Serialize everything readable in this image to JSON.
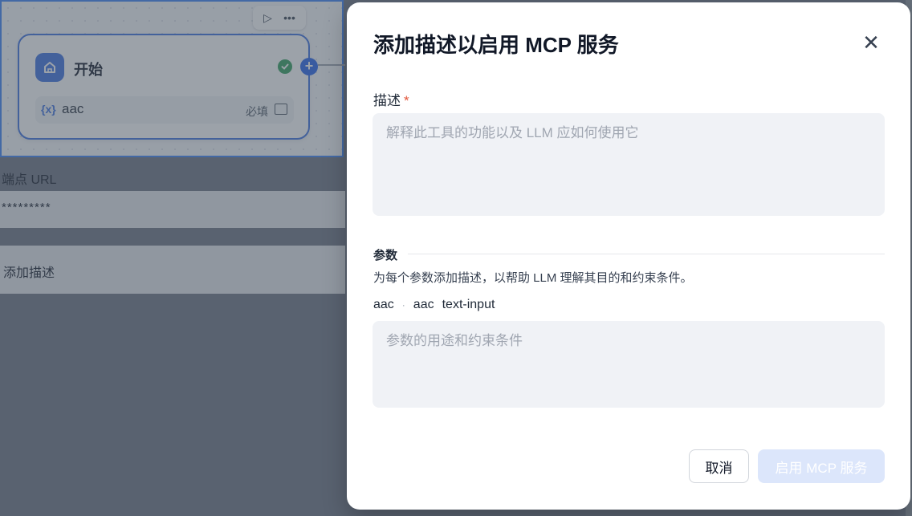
{
  "background": {
    "node": {
      "title": "开始",
      "variable_icon": "{x}",
      "variable_name": "aac",
      "required_label": "必填",
      "icons": [
        "play-icon",
        "more-icon",
        "home-icon",
        "check-icon",
        "add-icon",
        "text-type-icon"
      ]
    },
    "endpoint_label": "端点 URL",
    "endpoint_value": "*********",
    "add_description_label": "添加描述"
  },
  "modal": {
    "title": "添加描述以启用 MCP 服务",
    "close_icon": "close-icon",
    "description": {
      "label": "描述",
      "required_mark": "*",
      "placeholder": "解释此工具的功能以及 LLM 应如何使用它",
      "value": ""
    },
    "params": {
      "title": "参数",
      "hint": "为每个参数添加描述，以帮助 LLM 理解其目的和约束条件。",
      "items": [
        {
          "name": "aac",
          "separator": "·",
          "label": "aac",
          "type": "text-input",
          "placeholder": "参数的用途和约束条件",
          "value": ""
        }
      ]
    },
    "buttons": {
      "cancel": "取消",
      "enable": "启用 MCP 服务"
    }
  },
  "colors": {
    "accent": "#3b6fe0",
    "success": "#2f9e5c",
    "required": "#e2553a",
    "disabled_button": "#dce6fb"
  }
}
